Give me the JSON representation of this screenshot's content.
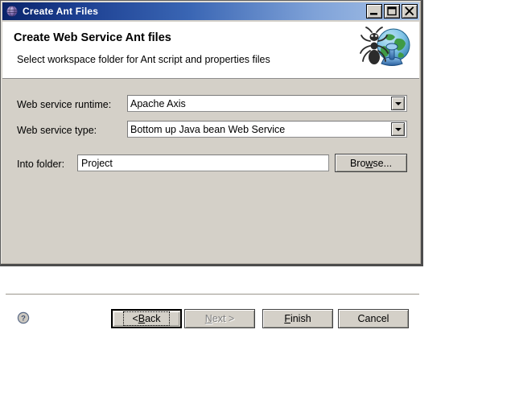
{
  "window": {
    "title": "Create Ant Files",
    "icon": "eclipse-globe-icon",
    "controls": {
      "minimize": "minimize-icon",
      "maximize": "maximize-icon",
      "close": "close-icon"
    }
  },
  "header": {
    "title": "Create Web Service Ant files",
    "subtitle": "Select workspace folder for Ant script and properties files",
    "icon": "ant-globe-icon"
  },
  "form": {
    "runtime": {
      "label": "Web service runtime:",
      "value": "Apache Axis"
    },
    "service_type": {
      "label": "Web service type:",
      "value": "Bottom up Java bean Web Service"
    },
    "folder": {
      "label": "Into folder:",
      "value": "Project",
      "browse_label": "Browse..."
    }
  },
  "buttons": {
    "help": "help-icon",
    "back": {
      "prefix": "< ",
      "mnemonic": "B",
      "suffix": "ack"
    },
    "next": {
      "mnemonic": "N",
      "suffix": "ext >"
    },
    "finish": {
      "mnemonic": "F",
      "suffix": "inish"
    },
    "cancel": "Cancel"
  },
  "colors": {
    "dialog_face": "#d4d0c8",
    "title_start": "#0a246a",
    "title_end": "#a9c4e8",
    "field_bg": "#ffffff",
    "disabled_text": "#808080"
  }
}
